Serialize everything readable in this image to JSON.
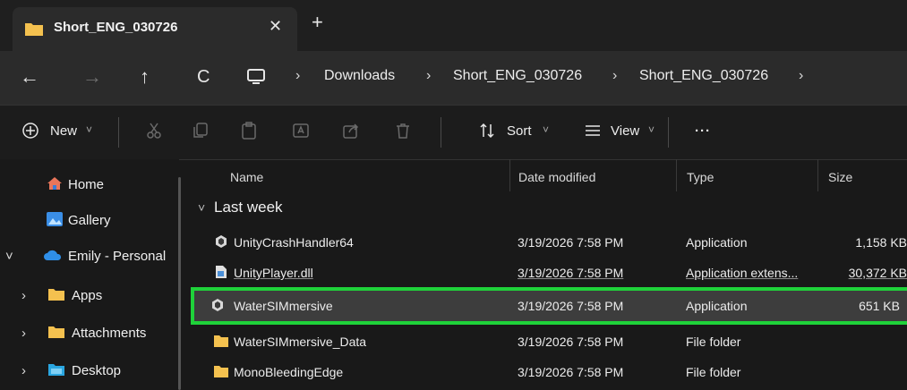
{
  "tab": {
    "title": "Short_ENG_030726",
    "close_glyph": "✕",
    "new_glyph": "+"
  },
  "nav": {
    "back_glyph": "←",
    "forward_glyph": "→",
    "up_glyph": "↑",
    "refresh_glyph": "C",
    "breadcrumb": [
      "Downloads",
      "Short_ENG_030726",
      "Short_ENG_030726"
    ],
    "separator": "›"
  },
  "toolbar": {
    "new_label": "New",
    "sort_label": "Sort",
    "view_label": "View",
    "more_label": "···",
    "caret": "˅"
  },
  "sidebar": {
    "items": [
      {
        "label": "Home",
        "chevron": "",
        "icon": "home-icon"
      },
      {
        "label": "Gallery",
        "chevron": "",
        "icon": "gallery-icon"
      },
      {
        "label": "Emily - Personal",
        "chevron": "˅",
        "icon": "cloud-icon"
      },
      {
        "label": "Apps",
        "chevron": "›",
        "icon": "folder-icon"
      },
      {
        "label": "Attachments",
        "chevron": "›",
        "icon": "folder-icon"
      },
      {
        "label": "Desktop",
        "chevron": "›",
        "icon": "desktop-folder-icon"
      }
    ]
  },
  "columns": {
    "name": "Name",
    "date": "Date modified",
    "type": "Type",
    "size": "Size"
  },
  "group": {
    "label": "Last week",
    "chevron": "˅"
  },
  "files": [
    {
      "name": "UnityCrashHandler64",
      "date": "3/19/2026 7:58 PM",
      "type": "Application",
      "size": "1,158 KB",
      "icon": "unity-app-icon"
    },
    {
      "name": "UnityPlayer.dll",
      "date": "3/19/2026 7:58 PM",
      "type": "Application extens...",
      "size": "30,372 KB",
      "icon": "dll-icon"
    },
    {
      "name": "WaterSIMmersive",
      "date": "3/19/2026 7:58 PM",
      "type": "Application",
      "size": "651 KB",
      "icon": "unity-app-icon"
    },
    {
      "name": "WaterSIMmersive_Data",
      "date": "3/19/2026 7:58 PM",
      "type": "File folder",
      "size": "",
      "icon": "folder-icon"
    },
    {
      "name": "MonoBleedingEdge",
      "date": "3/19/2026 7:58 PM",
      "type": "File folder",
      "size": "",
      "icon": "folder-icon"
    }
  ],
  "selected_file": "WaterSIMmersive",
  "colors": {
    "highlight": "#1fd23a",
    "folder": "#f4c14f",
    "background": "#191919"
  }
}
